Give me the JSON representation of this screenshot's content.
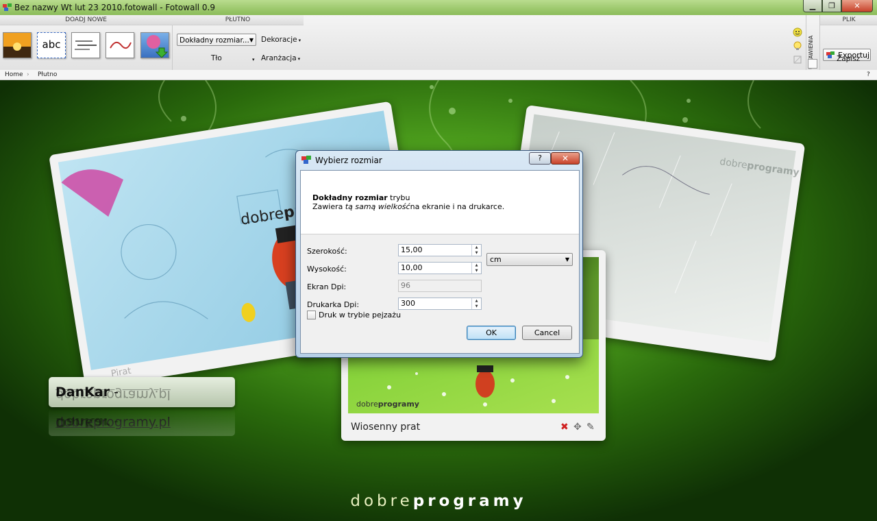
{
  "window": {
    "title": "Bez nazwy Wt lut 23 2010.fotowall - Fotowall 0.9"
  },
  "ribbon": {
    "group_add": {
      "header": "DOADJ NOWE",
      "items": [
        "picture-icon",
        "text-icon",
        "wordcloud-icon",
        "webcam-icon",
        "flickr-icon"
      ],
      "text_item_label": "abc"
    },
    "group_canvas": {
      "header": "PŁUTNO",
      "size_dropdown": "Dokładny rozmiar...",
      "decorations": "Dekoracje",
      "background": "Tło",
      "arrangement": "Aranżacja"
    },
    "settings_label": "USTAWIENIA",
    "group_file": {
      "header": "PLIK",
      "export": "Exportuj",
      "save": "Zapisz"
    },
    "help": "?"
  },
  "breadcrumb": {
    "items": [
      "Home",
      "Płutno"
    ]
  },
  "canvas": {
    "logo_regular": "dobre",
    "logo_bold": "programy",
    "photo_caption": "Wiosenny prat",
    "caption_author": "DanKar",
    "caption_sep": " - ",
    "caption_link": "dobreprogramy.pl",
    "pirate_label": "Pirat"
  },
  "dialog": {
    "title": "Wybierz rozmiar",
    "help": "?",
    "header_bold": "Dokładny rozmiar",
    "header_rest": " trybu",
    "desc_prefix": "Zawiera ",
    "desc_italic": "tą samą wielkość",
    "desc_suffix": "na ekranie i na drukarce.",
    "fields": {
      "width": {
        "label": "Szerokość:",
        "value": "15,00"
      },
      "height": {
        "label": "Wysokość:",
        "value": "10,00"
      },
      "screen_dpi": {
        "label": "Ekran Dpi:",
        "value": "96"
      },
      "printer_dpi": {
        "label": "Drukarka Dpi:",
        "value": "300"
      }
    },
    "unit": "cm",
    "landscape_label": "Druk w trybie pejzażu",
    "landscape_checked": false,
    "ok": "OK",
    "cancel": "Cancel"
  },
  "colors": {
    "ok_accent": "#3c7fb1",
    "close_red": "#c8422a",
    "background_green": "#4fa21e"
  }
}
